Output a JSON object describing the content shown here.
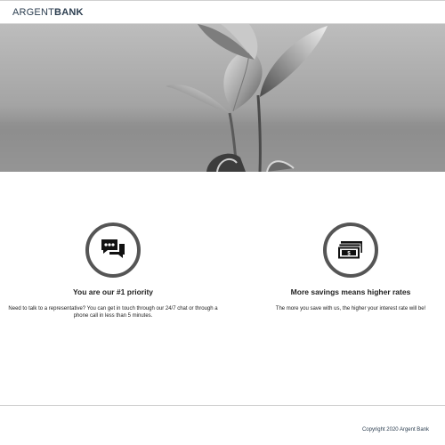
{
  "header": {
    "logo_part1": "ARGENT",
    "logo_part2": "BANK"
  },
  "features": [
    {
      "icon": "chat-icon",
      "title": "You are our #1 priority",
      "description": "Need to talk to a representative? You can get in touch through our 24/7 chat or through a phone call in less than 5 minutes."
    },
    {
      "icon": "money-icon",
      "title": "More savings means higher rates",
      "description": "The more you save with us, the higher your interest rate will be!"
    }
  ],
  "footer": {
    "copyright": "Copyright 2020 Argent Bank"
  },
  "colors": {
    "text": "#2c3e50",
    "icon_ring": "#555555"
  }
}
